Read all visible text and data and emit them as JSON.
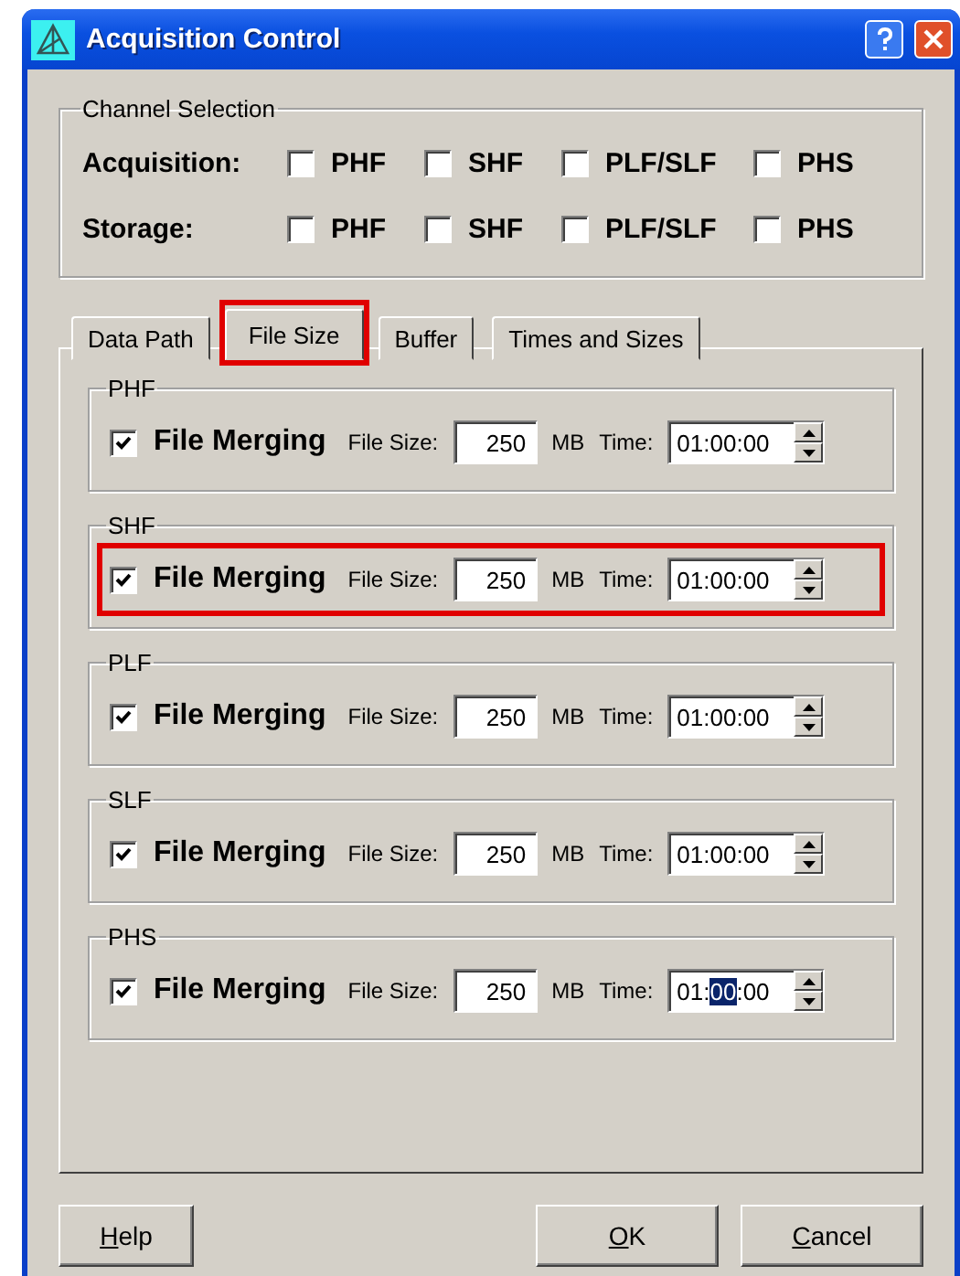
{
  "window": {
    "title": "Acquisition Control"
  },
  "channel_selection": {
    "label": "Channel Selection",
    "rows": [
      {
        "label": "Acquisition:",
        "channels": [
          {
            "label": "PHF",
            "checked": false
          },
          {
            "label": "SHF",
            "checked": false
          },
          {
            "label": "PLF/SLF",
            "checked": false
          },
          {
            "label": "PHS",
            "checked": false
          }
        ]
      },
      {
        "label": "Storage:",
        "channels": [
          {
            "label": "PHF",
            "checked": false
          },
          {
            "label": "SHF",
            "checked": false
          },
          {
            "label": "PLF/SLF",
            "checked": false
          },
          {
            "label": "PHS",
            "checked": false
          }
        ]
      }
    ]
  },
  "tabs": [
    {
      "label": "Data Path",
      "selected": false,
      "highlighted": false
    },
    {
      "label": "File Size",
      "selected": true,
      "highlighted": true
    },
    {
      "label": "Buffer",
      "selected": false,
      "highlighted": false
    },
    {
      "label": "Times and Sizes",
      "selected": false,
      "highlighted": false
    }
  ],
  "groups": [
    {
      "label": "PHF",
      "highlighted": false,
      "merging": {
        "label": "File Merging",
        "checked": true
      },
      "size_label": "File Size:",
      "size": "250",
      "unit": "MB",
      "time_label": "Time:",
      "time_parts": [
        {
          "text": "01:",
          "selected": false
        },
        {
          "text": "00",
          "selected": false
        },
        {
          "text": ":00",
          "selected": false
        }
      ]
    },
    {
      "label": "SHF",
      "highlighted": true,
      "merging": {
        "label": "File Merging",
        "checked": true
      },
      "size_label": "File Size:",
      "size": "250",
      "unit": "MB",
      "time_label": "Time:",
      "time_parts": [
        {
          "text": "01:",
          "selected": false
        },
        {
          "text": "00",
          "selected": false
        },
        {
          "text": ":00",
          "selected": false
        }
      ]
    },
    {
      "label": "PLF",
      "highlighted": false,
      "merging": {
        "label": "File Merging",
        "checked": true
      },
      "size_label": "File Size:",
      "size": "250",
      "unit": "MB",
      "time_label": "Time:",
      "time_parts": [
        {
          "text": "01:",
          "selected": false
        },
        {
          "text": "00",
          "selected": false
        },
        {
          "text": ":00",
          "selected": false
        }
      ]
    },
    {
      "label": "SLF",
      "highlighted": false,
      "merging": {
        "label": "File Merging",
        "checked": true
      },
      "size_label": "File Size:",
      "size": "250",
      "unit": "MB",
      "time_label": "Time:",
      "time_parts": [
        {
          "text": "01:",
          "selected": false
        },
        {
          "text": "00",
          "selected": false
        },
        {
          "text": ":00",
          "selected": false
        }
      ]
    },
    {
      "label": "PHS",
      "highlighted": false,
      "merging": {
        "label": "File Merging",
        "checked": true
      },
      "size_label": "File Size:",
      "size": "250",
      "unit": "MB",
      "time_label": "Time:",
      "time_parts": [
        {
          "text": "01:",
          "selected": false
        },
        {
          "text": "00",
          "selected": true
        },
        {
          "text": ":00",
          "selected": false
        }
      ]
    }
  ],
  "buttons": [
    {
      "label": "Help"
    },
    {
      "label": "OK"
    },
    {
      "label": "Cancel"
    }
  ]
}
